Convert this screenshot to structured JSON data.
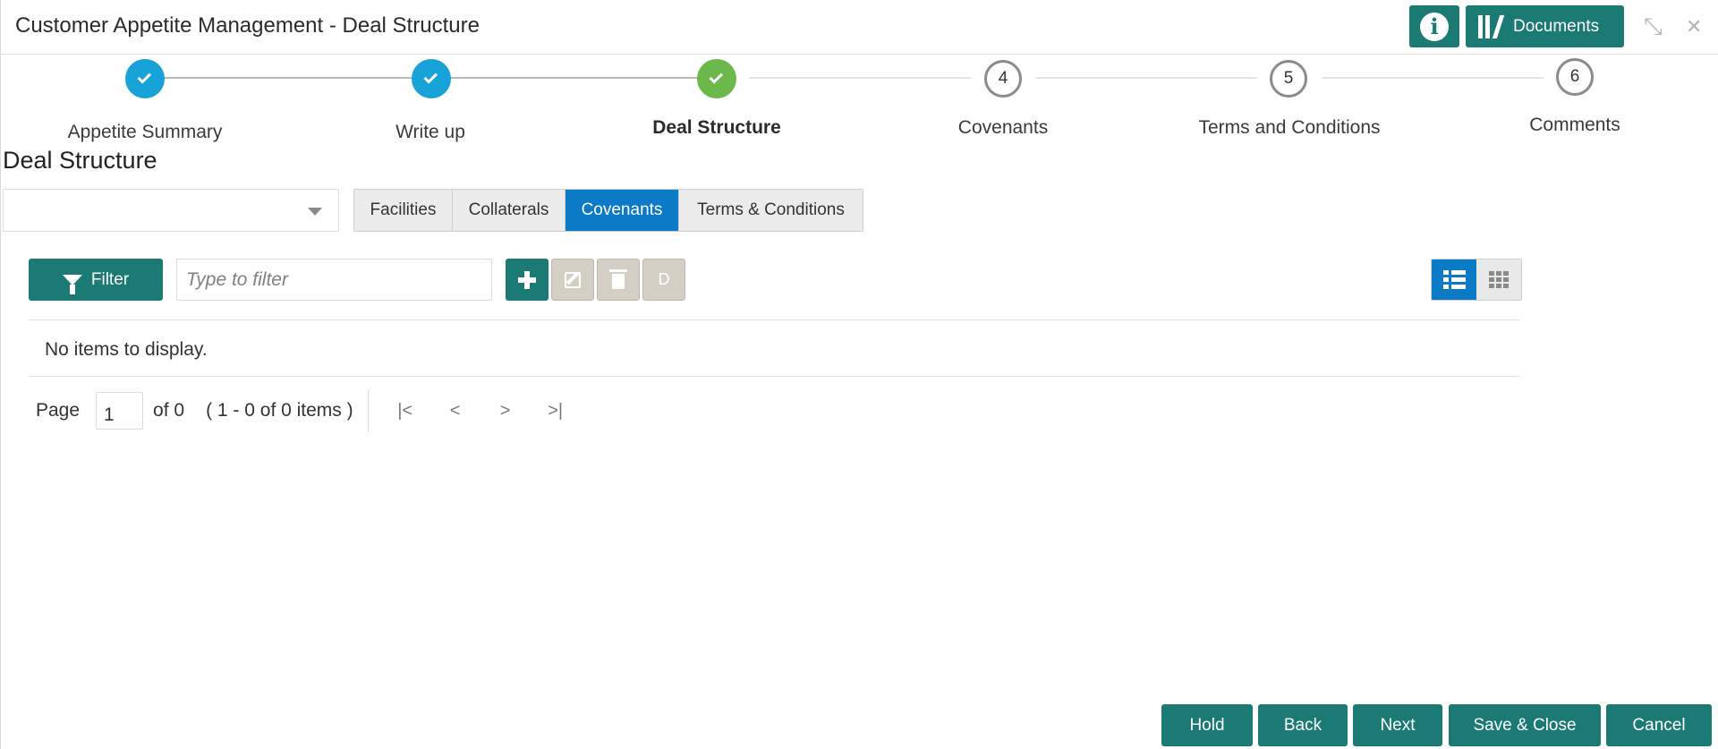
{
  "window": {
    "title": "Customer Appetite Management - Deal Structure",
    "info_label": "i",
    "documents_label": "Documents",
    "minimize_glyph": "⤡",
    "close_glyph": "✕"
  },
  "stepper": {
    "steps": [
      {
        "number": "",
        "label": "Appetite Summary",
        "status": "completed"
      },
      {
        "number": "",
        "label": "Write up",
        "status": "completed"
      },
      {
        "number": "",
        "label": "Deal Structure",
        "status": "current"
      },
      {
        "number": "4",
        "label": "Covenants",
        "status": "pending"
      },
      {
        "number": "5",
        "label": "Terms and Conditions",
        "status": "pending"
      },
      {
        "number": "6",
        "label": "Comments",
        "status": "pending"
      }
    ]
  },
  "section": {
    "title": "Deal Structure",
    "dropdown_value": ""
  },
  "tabs": [
    {
      "label": "Facilities",
      "active": false
    },
    {
      "label": "Collaterals",
      "active": false
    },
    {
      "label": "Covenants",
      "active": true
    },
    {
      "label": "Terms & Conditions",
      "active": false
    }
  ],
  "toolbar": {
    "filter_label": "Filter",
    "filter_placeholder": "Type to filter",
    "delete_letter": "D",
    "view_mode": "list"
  },
  "table": {
    "empty_message": "No items to display."
  },
  "pagination": {
    "page_label": "Page",
    "current_page": "1",
    "of_label": "of 0",
    "range_label": "( 1 - 0 of 0 items )",
    "first_glyph": "|<",
    "prev_glyph": "<",
    "next_glyph": ">",
    "last_glyph": ">|"
  },
  "footer": {
    "hold": "Hold",
    "back": "Back",
    "next": "Next",
    "save_close": "Save & Close",
    "cancel": "Cancel"
  },
  "colors": {
    "primary_teal": "#1c7a74",
    "active_blue": "#0b7bc8",
    "step_done_blue": "#18a3d8",
    "step_current_green": "#6cb84a"
  }
}
